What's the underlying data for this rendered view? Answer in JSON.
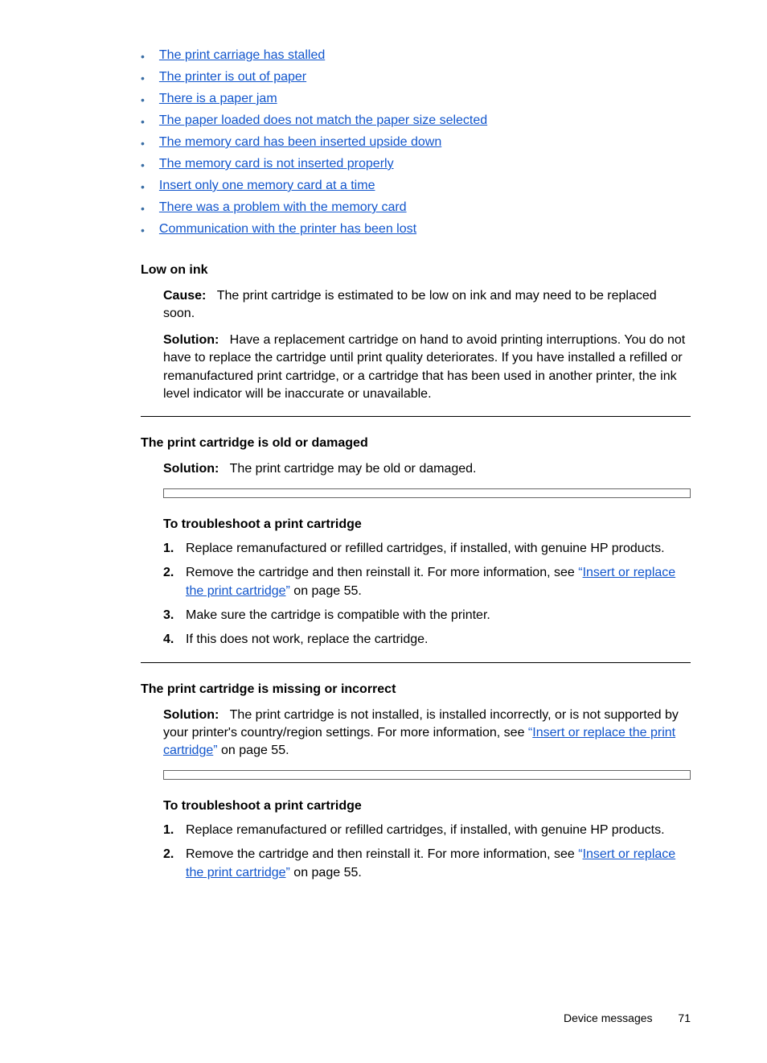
{
  "bullets": [
    "The print carriage has stalled",
    "The printer is out of paper",
    "There is a paper jam",
    "The paper loaded does not match the paper size selected",
    "The memory card has been inserted upside down",
    "The memory card is not inserted properly",
    "Insert only one memory card at a time",
    "There was a problem with the memory card",
    "Communication with the printer has been lost"
  ],
  "headings": {
    "low_on_ink": "Low on ink",
    "old_damaged": "The print cartridge is old or damaged",
    "missing_incorrect": "The print cartridge is missing or incorrect",
    "troubleshoot1": "To troubleshoot a print cartridge",
    "troubleshoot2": "To troubleshoot a print cartridge"
  },
  "labels": {
    "cause": "Cause:",
    "solution": "Solution:"
  },
  "text": {
    "low_on_ink_cause": "The print cartridge is estimated to be low on ink and may need to be replaced soon.",
    "low_on_ink_solution": "Have a replacement cartridge on hand to avoid printing interruptions. You do not have to replace the cartridge until print quality deteriorates. If you have installed a refilled or remanufactured print cartridge, or a cartridge that has been used in another printer, the ink level indicator will be inaccurate or unavailable.",
    "old_damaged_solution": "The print cartridge may be old or damaged.",
    "missing_incorrect_solution_pre": "The print cartridge is not installed, is installed incorrectly, or is not supported by your printer's country/region settings. For more information, see ",
    "link_insert_replace": "Insert or replace the print cartridge",
    "on_page_55": " on page 55.",
    "quote_open": "“",
    "quote_close": "”"
  },
  "steps1": {
    "s1": "Replace remanufactured or refilled cartridges, if installed, with genuine HP products.",
    "s2_pre": "Remove the cartridge and then reinstall it. For more information, see ",
    "s3": "Make sure the cartridge is compatible with the printer.",
    "s4": "If this does not work, replace the cartridge."
  },
  "steps2": {
    "s1": "Replace remanufactured or refilled cartridges, if installed, with genuine HP products.",
    "s2_pre": "Remove the cartridge and then reinstall it. For more information, see "
  },
  "nums": {
    "n1": "1.",
    "n2": "2.",
    "n3": "3.",
    "n4": "4."
  },
  "footer": {
    "label": "Device messages",
    "page": "71"
  }
}
